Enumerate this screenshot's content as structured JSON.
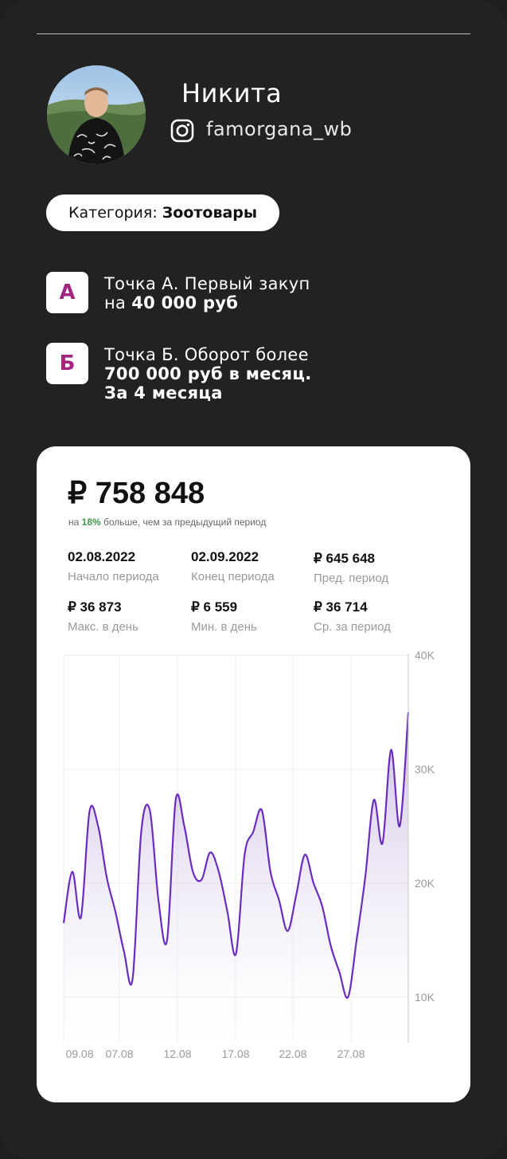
{
  "profile": {
    "name": "Никита",
    "handle": "famorgana_wb",
    "category_label": "Категория: ",
    "category_value": "Зоотовары"
  },
  "points": [
    {
      "badge": "А",
      "line1": "Точка А. Первый закуп",
      "line2_prefix": "на ",
      "line2_bold": "40 000 руб",
      "line3_bold": ""
    },
    {
      "badge": "Б",
      "line1": "Точка Б. Оборот более",
      "line2_prefix": "",
      "line2_bold": "700 000 руб в месяц.",
      "line3_bold": "За 4 месяца"
    }
  ],
  "report": {
    "total": "₽ 758 848",
    "subtitle_prefix": "на ",
    "subtitle_pct": "18%",
    "subtitle_suffix": " больше, чем за предыдущий период",
    "stats": [
      {
        "value": "02.08.2022",
        "label": "Начало периода"
      },
      {
        "value": "02.09.2022",
        "label": "Конец периода"
      },
      {
        "value": "₽ 645 648",
        "label": "Пред. период"
      },
      {
        "value": "₽ 36 873",
        "label": "Макс. в день"
      },
      {
        "value": "₽ 6 559",
        "label": "Мин. в день"
      },
      {
        "value": "₽ 36 714",
        "label": "Ср. за период"
      }
    ]
  },
  "colors": {
    "background": "#222222",
    "badge_text": "#a4257f",
    "line": "#6a2dbd",
    "positive": "#3e9b4f"
  },
  "chart_data": {
    "type": "area",
    "x_ticks": [
      "09.08",
      "07.08",
      "12.08",
      "17.08",
      "22.08",
      "27.08"
    ],
    "y_ticks": [
      "10K",
      "20K",
      "30K",
      "40K"
    ],
    "ylim": [
      6000,
      40500
    ],
    "grid": true,
    "series": [
      {
        "values": [
          16500,
          21000,
          17000,
          26300,
          25000,
          20500,
          17500,
          14000,
          11600,
          24500,
          26400,
          18500,
          15000,
          27300,
          25000,
          21000,
          20300,
          22700,
          21000,
          17500,
          13800,
          22500,
          24500,
          26400,
          21000,
          18500,
          15800,
          19000,
          22500,
          20000,
          18000,
          14500,
          12200,
          10000,
          15000,
          20500,
          27300,
          23500,
          31700,
          25000,
          35000
        ]
      }
    ]
  }
}
